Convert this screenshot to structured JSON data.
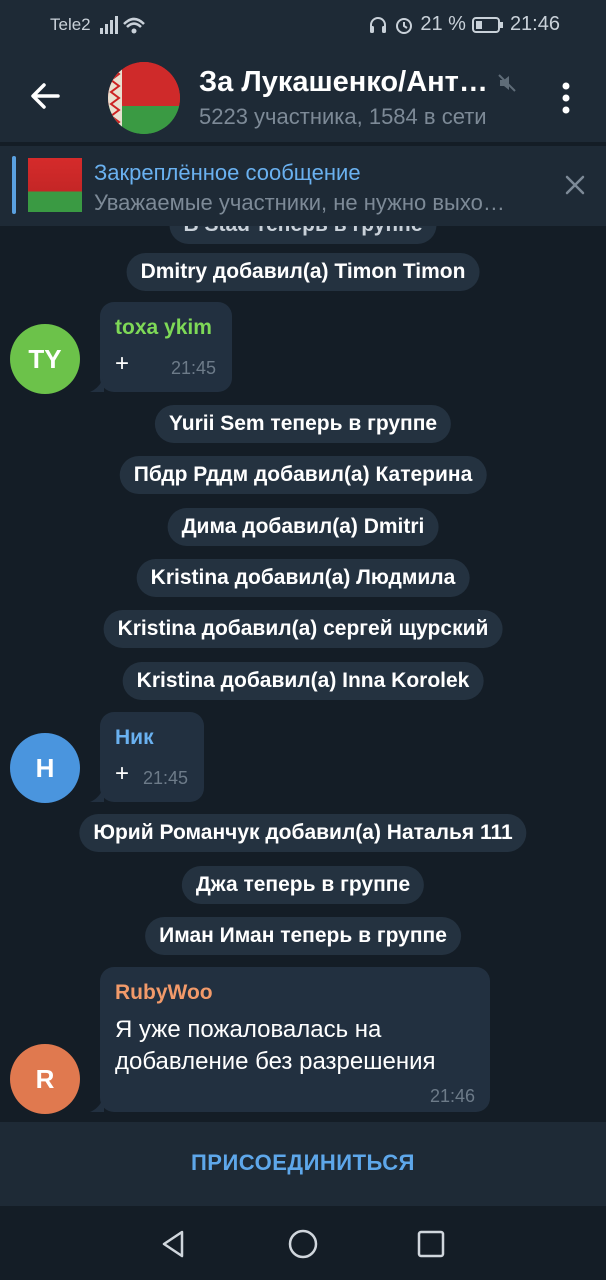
{
  "status_bar": {
    "carrier": "Tele2",
    "battery": "21 %",
    "time": "21:46"
  },
  "header": {
    "title": "За Лукашенко/Ант…",
    "subtitle": "5223 участника, 1584 в сети"
  },
  "pinned": {
    "title": "Закреплённое сообщение",
    "text": "Уважаемые участники, не нужно выхо…"
  },
  "messages": {
    "partial": "В Stad теперь в группе",
    "s1": "Dmitry добавил(а) Timon Timon",
    "m1": {
      "avatar": "TY",
      "author": "toxa ykim",
      "text": "+",
      "time": "21:45",
      "avatar_color": "#6cc24a",
      "author_color": "#7ed957"
    },
    "s2": "Yurii Sem теперь в группе",
    "s3": "Пбдр Рддм добавил(а) Катерина",
    "s4": "Дима добавил(а) Dmitri",
    "s5": "Kristina добавил(а) Людмила",
    "s6": "Kristina добавил(а) сергей щурский",
    "s7": "Kristina добавил(а) Inna Korolek",
    "m2": {
      "avatar": "Н",
      "author": "Ник",
      "text": "+",
      "time": "21:45",
      "avatar_color": "#4a95de",
      "author_color": "#6ab1f0"
    },
    "s8": "Юрий Романчук добавил(а) Наталья 111",
    "s9": "Джа теперь в группе",
    "s10": "Иман Иман теперь в группе",
    "m3": {
      "avatar": "R",
      "author": "RubyWoo",
      "line1": "Я уже пожаловалась на",
      "line2": "добавление без разрешения",
      "time": "21:46",
      "avatar_color": "#e0794f",
      "author_color": "#f29a6a"
    }
  },
  "join": {
    "label": "ПРИСОЕДИНИТЬСЯ"
  }
}
